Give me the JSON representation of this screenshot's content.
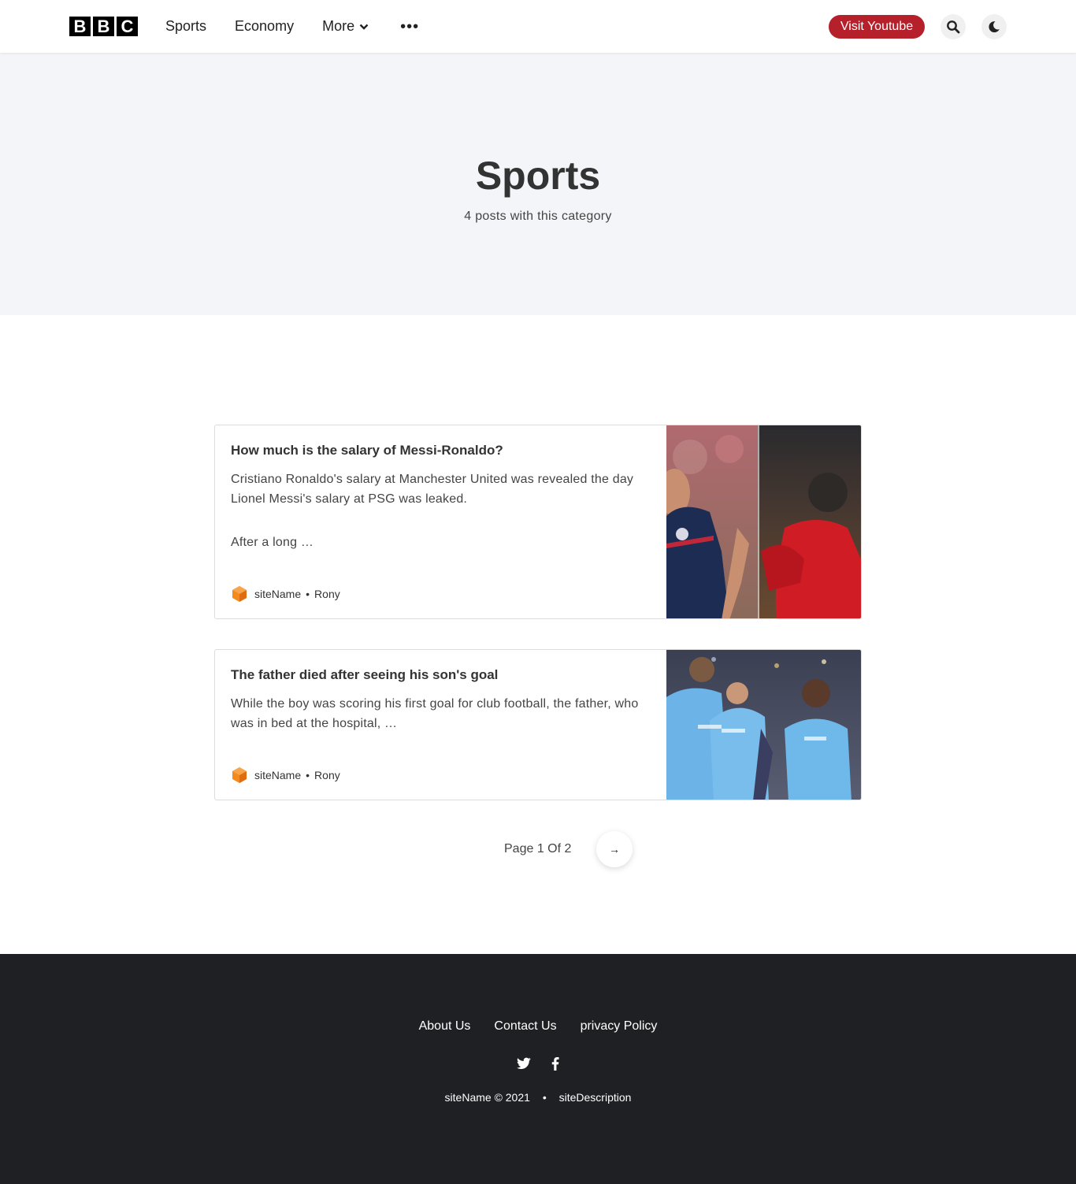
{
  "header": {
    "logo_letters": [
      "B",
      "B",
      "C"
    ],
    "nav": {
      "sports": "Sports",
      "economy": "Economy",
      "more": "More",
      "overflow": "•••"
    },
    "youtube_button": "Visit Youtube",
    "accent_color": "#b5202b"
  },
  "hero": {
    "title": "Sports",
    "subtitle": "4 posts with this category"
  },
  "posts": [
    {
      "title": "How much is the salary of Messi-Ronaldo?",
      "excerpt_1": "Cristiano Ronaldo's salary at Manchester United was revealed the day Lionel Messi's salary at PSG was leaked.",
      "excerpt_2": "After a long …",
      "site": "siteName",
      "separator": "•",
      "author": "Rony"
    },
    {
      "title": "The father died after seeing his son's goal",
      "excerpt_1": "While the boy was scoring his first goal for club football, the father, who was in bed at the hospital, …",
      "site": "siteName",
      "separator": "•",
      "author": "Rony"
    }
  ],
  "pagination": {
    "label": "Page 1 Of 2",
    "next_icon": "→"
  },
  "footer": {
    "links": {
      "about": "About Us",
      "contact": "Contact Us",
      "privacy": "privacy Policy"
    },
    "social_icons": [
      "twitter-icon",
      "facebook-icon"
    ],
    "copyright": "siteName © 2021",
    "bullet": "•",
    "description": "siteDescription",
    "background": "#1f2023"
  }
}
